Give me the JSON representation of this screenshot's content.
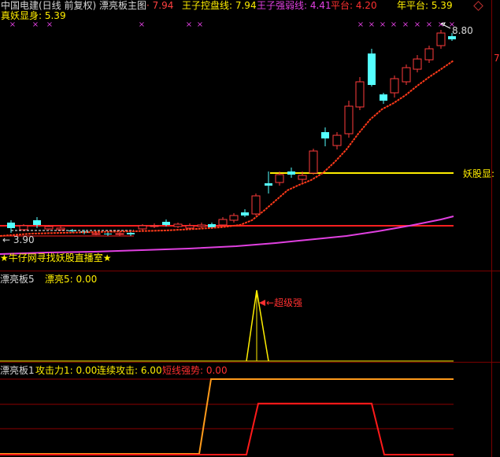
{
  "main_panel": {
    "title": "中国电建(日线 前复权) 漂亮板主图",
    "ind_val1": "· 7.94",
    "line1_label": "王子控盘线: 7.94",
    "line2_label": "王子强弱线: 4.41",
    "platform_label": "平台: 4.20",
    "year_platform_label": "年平台: 5.39",
    "line2_text": "真妖显身: 5.39",
    "high_marker": "8.80",
    "low_marker": "← 3.90",
    "yaogu_label": "妖股显:",
    "footer_text": "★牛仔网寻找妖股直播室★",
    "right_tick": "7"
  },
  "panel2": {
    "name": "漂亮板5",
    "value_label": "漂亮5: 0.00",
    "annotation": "←超级强"
  },
  "panel3": {
    "name": "漂亮板1",
    "attack_label": "攻击力1: 0.00",
    "cont_label": "连续攻击: 6.00",
    "short_label": "短线强势: 0.00"
  },
  "colors": {
    "bull_candle": "#ff3b3b",
    "bear_candle": "#54ffff",
    "ma_line": "#ff3a1a",
    "long_line": "#e040e0",
    "platform": "#ff2020",
    "yellow_line": "#ffee00",
    "magenta_marks": "#e040e0"
  }
}
